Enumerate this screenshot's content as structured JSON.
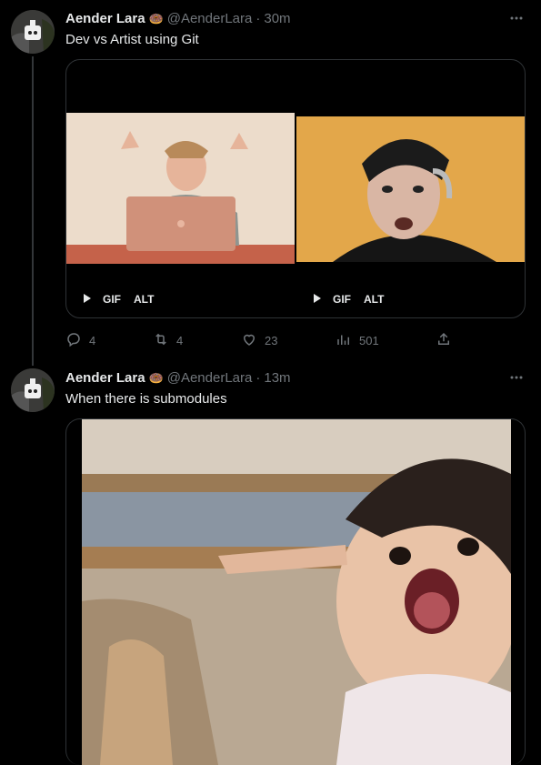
{
  "tweets": [
    {
      "author": "Aender Lara",
      "emoji": "🍩",
      "handle": "@AenderLara",
      "separator": "·",
      "time": "30m",
      "text": "Dev vs Artist using Git",
      "media": [
        {
          "type": "gif",
          "gif_label": "GIF",
          "alt_label": "ALT"
        },
        {
          "type": "gif",
          "gif_label": "GIF",
          "alt_label": "ALT"
        }
      ],
      "actions": {
        "replies": "4",
        "reposts": "4",
        "likes": "23",
        "views": "501"
      }
    },
    {
      "author": "Aender Lara",
      "emoji": "🍩",
      "handle": "@AenderLara",
      "separator": "·",
      "time": "13m",
      "text": "When there is submodules"
    }
  ],
  "icons": {
    "reply": "reply-icon",
    "repost": "repost-icon",
    "like": "heart-icon",
    "views": "bar-chart-icon",
    "share": "share-icon",
    "more": "more-icon",
    "play": "play-icon"
  },
  "colors": {
    "background": "#000000",
    "muted": "#71767b",
    "text": "#e7e9ea",
    "border": "#2f3336"
  }
}
